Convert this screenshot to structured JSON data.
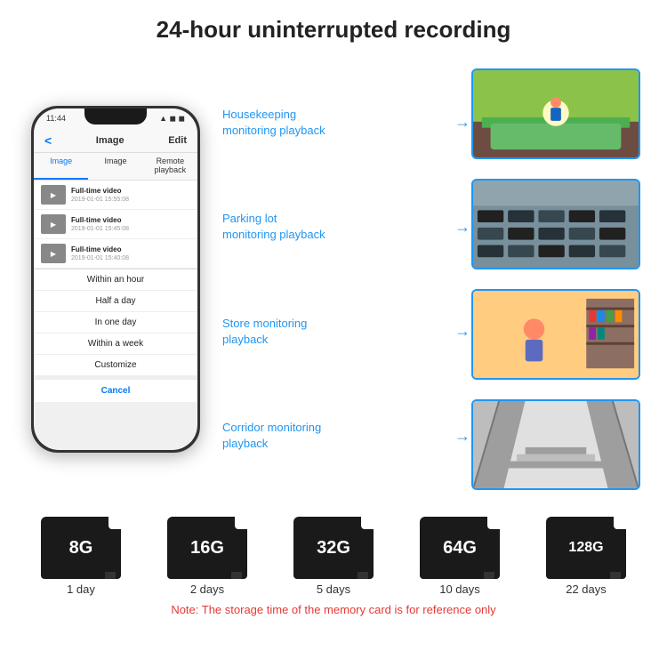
{
  "header": {
    "title": "24-hour uninterrupted recording"
  },
  "phone": {
    "status_time": "11:44",
    "nav_back": "<",
    "nav_title": "Image",
    "nav_edit": "Edit",
    "tabs": [
      "Image",
      "Image",
      "Remote playback"
    ],
    "list_items": [
      {
        "label": "Full-time video",
        "date": "2019-01-01 15:55:08"
      },
      {
        "label": "Full-time video",
        "date": "2019-01-01 15:45:08"
      },
      {
        "label": "Full-time video",
        "date": "2019-01-01 15:40:08"
      }
    ],
    "dropdown": [
      "Within an hour",
      "Half a day",
      "In one day",
      "Within a week",
      "Customize"
    ],
    "cancel": "Cancel"
  },
  "monitoring": {
    "labels": [
      "Housekeeping\nmonitoring playback",
      "Parking lot\nmonitoring playback",
      "Store monitoring\nplayback",
      "Corridor monitoring\nplayback"
    ]
  },
  "storage": {
    "cards": [
      {
        "size": "8G",
        "days": "1 day"
      },
      {
        "size": "16G",
        "days": "2 days"
      },
      {
        "size": "32G",
        "days": "5 days"
      },
      {
        "size": "64G",
        "days": "10 days"
      },
      {
        "size": "128G",
        "days": "22 days"
      }
    ],
    "note": "Note: The storage time of the memory card is for reference only"
  }
}
